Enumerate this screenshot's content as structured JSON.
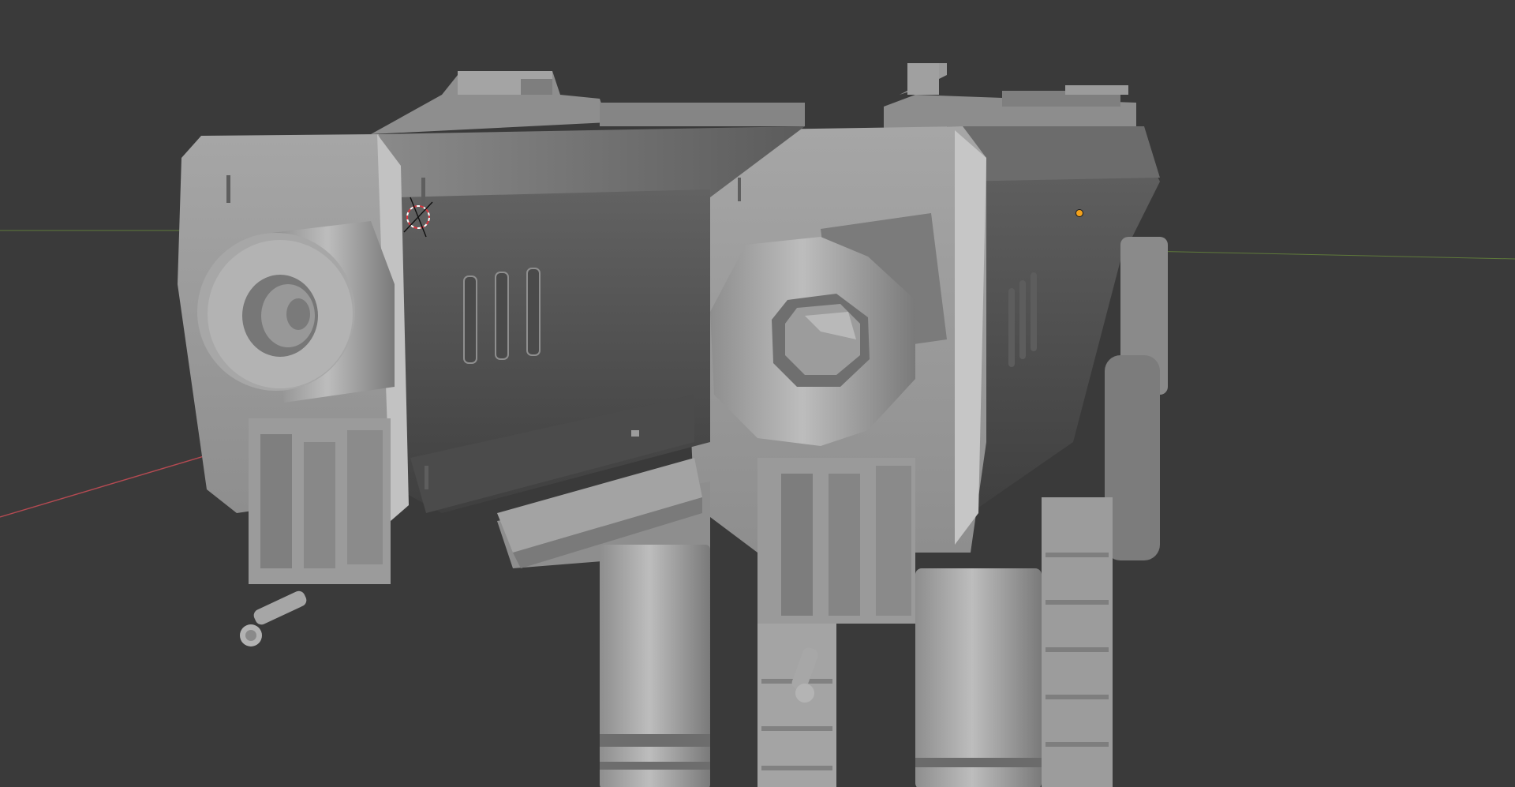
{
  "viewport": {
    "name": "3D Viewport",
    "background_color": "#3a3a3a",
    "axis_x_color": "#b54a52",
    "axis_y_color": "#6a8a3a",
    "model_base_color": "#8c8c8c",
    "model_light_color": "#b4b4b4",
    "model_dark_color": "#4e4e4e",
    "selection_origin_color": "#f4a21c",
    "cursor_color": "#d9363e",
    "cursor_icon": "3d-cursor-icon",
    "origin_icon": "object-origin-dot-icon"
  }
}
